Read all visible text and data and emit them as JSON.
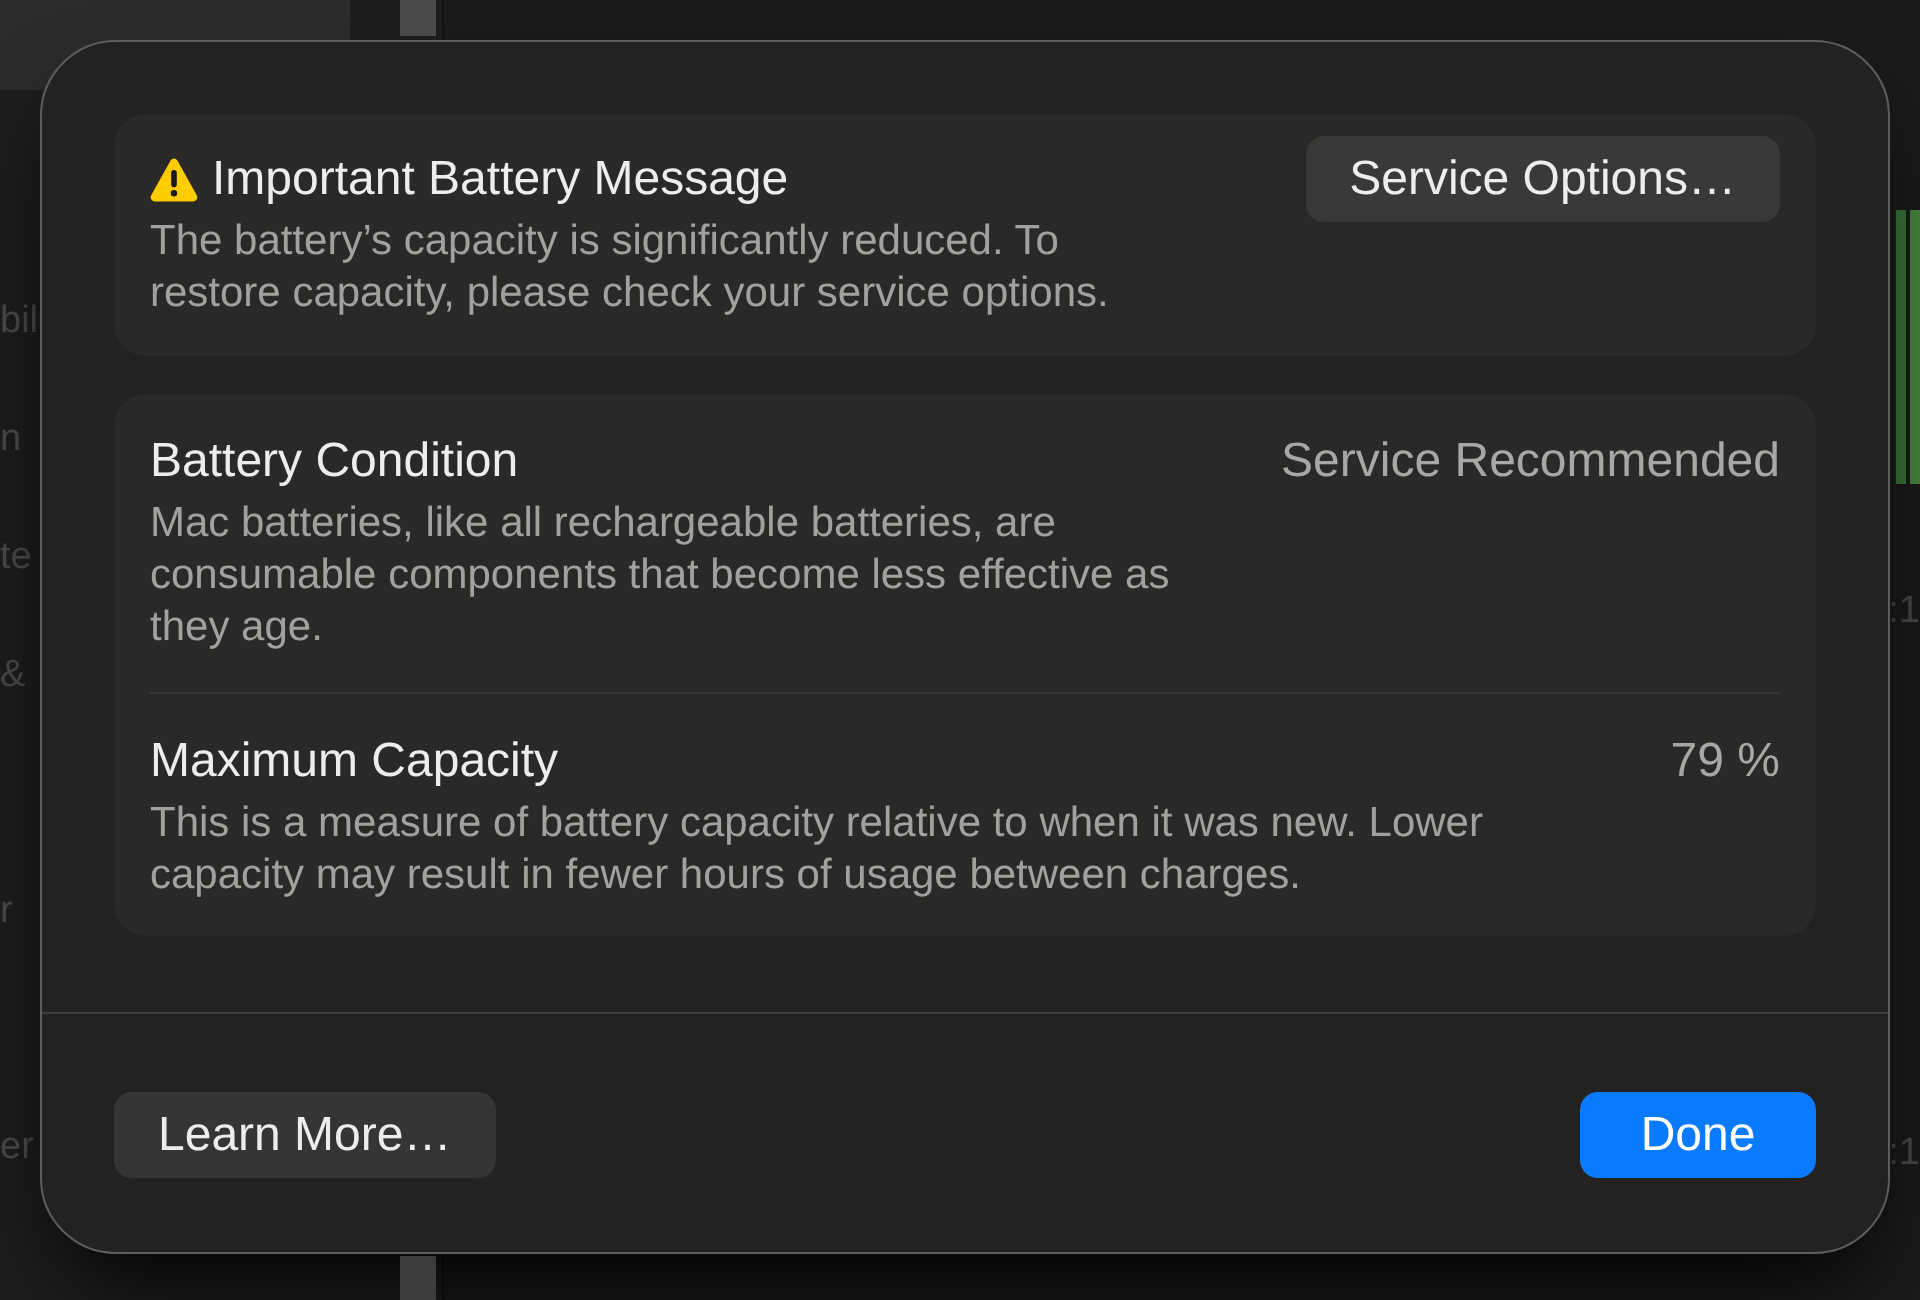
{
  "background": {
    "sidebar_fragments": [
      "bil",
      "n",
      "te",
      "&",
      "r",
      "er"
    ],
    "content_fragments": [
      ":1",
      ":1"
    ]
  },
  "dialog": {
    "alert": {
      "title": "Important Battery Message",
      "message": "The battery’s capacity is significantly reduced. To restore capacity, please check your service options.",
      "button": "Service Options…"
    },
    "details": [
      {
        "title": "Battery Condition",
        "value": "Service Recommended",
        "description": "Mac batteries, like all rechargeable batteries, are consumable components that become less effective as they age."
      },
      {
        "title": "Maximum Capacity",
        "value": "79 %",
        "description": "This is a measure of battery capacity relative to when it was new. Lower capacity may result in fewer hours of usage between charges."
      }
    ],
    "buttons": [
      {
        "label": "Learn More…",
        "kind": "secondary"
      },
      {
        "label": "Done",
        "kind": "primary"
      }
    ]
  }
}
